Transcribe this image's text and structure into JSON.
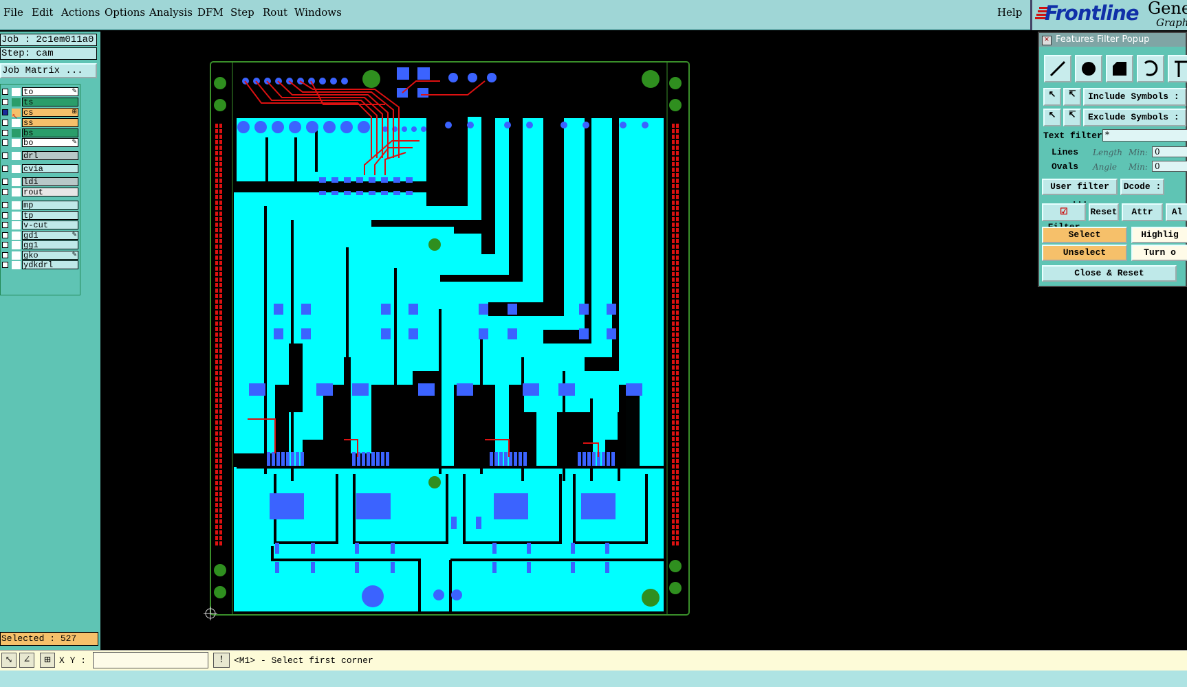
{
  "menu": {
    "items": [
      "File",
      "Edit",
      "Actions",
      "Options",
      "Analysis",
      "DFM",
      "Step",
      "Rout",
      "Windows"
    ],
    "help": "Help"
  },
  "brand": {
    "logo": "Frontline",
    "product": "Genes",
    "subtitle": "Graph"
  },
  "left_panel": {
    "job": "Job : 2c1em011a0",
    "step": "Step: cam",
    "job_matrix_button": "Job Matrix ...",
    "layers": [
      {
        "name": "to",
        "color": "#ffffff",
        "swatch": "#ffffff",
        "mark": "✎"
      },
      {
        "name": "ts",
        "color": "#2a9d6a",
        "swatch": "#2a9d6a",
        "mark": ""
      },
      {
        "name": "cs",
        "color": "#f6c06a",
        "swatch": "#ffffff",
        "mark": "⊞",
        "active": true
      },
      {
        "name": "ss",
        "color": "#f6c06a",
        "swatch": "#ffffff",
        "mark": ""
      },
      {
        "name": "bs",
        "color": "#2a9d6a",
        "swatch": "#2a9d6a",
        "mark": ""
      },
      {
        "name": "bo",
        "color": "#ffffff",
        "swatch": "#ffffff",
        "mark": "✎"
      },
      {
        "name": "drl",
        "color": "#b8c8c8",
        "swatch": "#ffffff",
        "mark": ""
      },
      {
        "name": "cvia",
        "color": "#bfe9e9",
        "swatch": "#ffffff",
        "mark": ""
      },
      {
        "name": "ldi",
        "color": "#b8c8c8",
        "swatch": "#ffffff",
        "mark": ""
      },
      {
        "name": "rout",
        "color": "#e6e6e6",
        "swatch": "#ffffff",
        "mark": ""
      },
      {
        "name": "mp",
        "color": "#bfe9e9",
        "swatch": "#ffffff",
        "mark": ""
      },
      {
        "name": "tp",
        "color": "#bfe9e9",
        "swatch": "#ffffff",
        "mark": ""
      },
      {
        "name": "v-cut",
        "color": "#bfe9e9",
        "swatch": "#ffffff",
        "mark": ""
      },
      {
        "name": "gd1",
        "color": "#bfe9e9",
        "swatch": "#ffffff",
        "mark": "✎"
      },
      {
        "name": "gg1",
        "color": "#bfe9e9",
        "swatch": "#ffffff",
        "mark": ""
      },
      {
        "name": "gko",
        "color": "#bfe9e9",
        "swatch": "#ffffff",
        "mark": "✎"
      },
      {
        "name": "ydkdrl",
        "color": "#bfe9e9",
        "swatch": "#ffffff",
        "mark": ""
      }
    ],
    "selected": "Selected : 527"
  },
  "status": {
    "xy_label": "X Y :",
    "xy_value": "",
    "prompt": "<M1> - Select first corner"
  },
  "popup": {
    "title": "Features Filter Popup",
    "include": "Include Symbols :",
    "exclude": "Exclude Symbols :",
    "text_filter": "Text filter",
    "text_filter_value": "*",
    "lines": "Lines",
    "ovals": "Ovals",
    "length": "Length",
    "angle": "Angle",
    "min": "Min:",
    "min_value": "0",
    "user_filter": "User filter ...",
    "dcode": "Dcode :",
    "filter": "Filter",
    "reset": "Reset",
    "attr": "Attr ...",
    "al": "Al",
    "select": "Select",
    "highlight": "Highlig",
    "unselect": "Unselect",
    "turn_off": "Turn o",
    "close_reset": "Close & Reset"
  },
  "colors": {
    "copper": "#00ffff",
    "pad": "#3b63ff",
    "trace": "#dd1111",
    "mounting": "#2f8f1f",
    "bg": "#000000"
  }
}
